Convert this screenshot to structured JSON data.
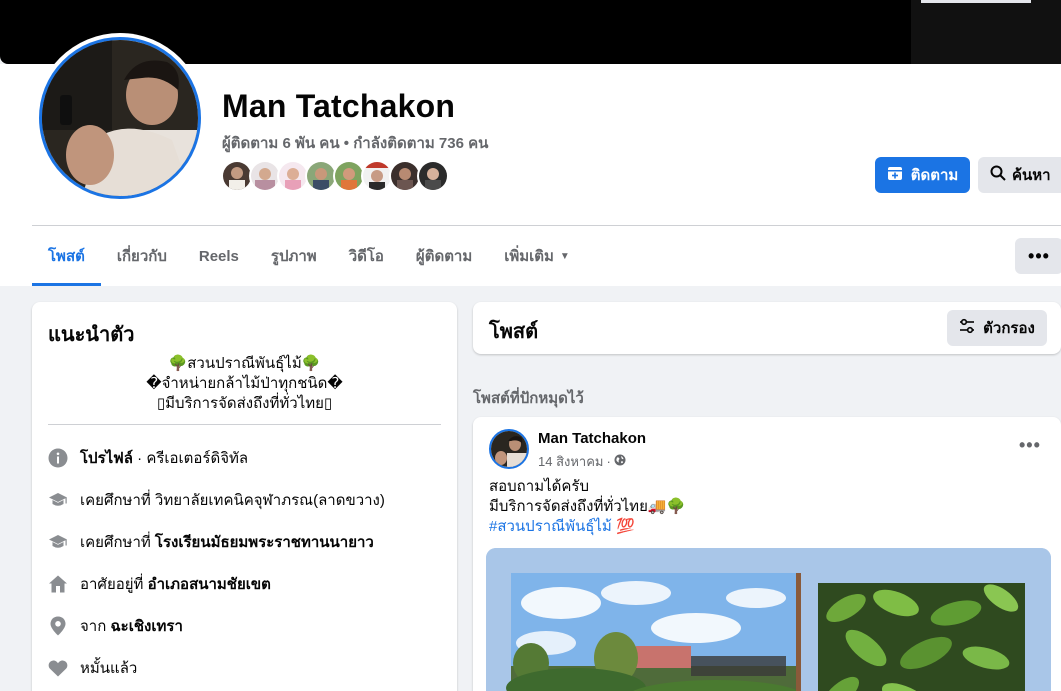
{
  "profile": {
    "name": "Man Tatchakon",
    "followers_text": "ผู้ติดตาม 6 พัน คน",
    "separator": " • ",
    "following_text": "กำลังติดตาม 736 คน",
    "follow_label": "ติดตาม",
    "search_label": "ค้นหา",
    "more_label": "•••"
  },
  "tabs": [
    {
      "label": "โพสต์"
    },
    {
      "label": "เกี่ยวกับ"
    },
    {
      "label": "Reels"
    },
    {
      "label": "รูปภาพ"
    },
    {
      "label": "วิดีโอ"
    },
    {
      "label": "ผู้ติดตาม"
    },
    {
      "label": "เพิ่มเติม"
    }
  ],
  "intro": {
    "title": "แนะนำตัว",
    "bio_lines": [
      "🌳สวนปราณีพันธุ์ไม้🌳",
      "�จำหน่ายกล้าไม้ป่าทุกชนิด�",
      "▯มีบริการจัดส่งถึงที่ทั่วไทย▯"
    ],
    "rows": [
      {
        "prefix": "",
        "bold": "โปรไฟล์",
        "suffix": " · ครีเอเตอร์ดิจิทัล",
        "icon": "info-icon"
      },
      {
        "prefix": "เคยศึกษาที่ ",
        "bold": "",
        "suffix": "วิทยาลัยเทคนิคจุฬาภรณ(ลาดขวาง)",
        "icon": "graduation-cap-icon"
      },
      {
        "prefix": "เคยศึกษาที่ ",
        "bold": "โรงเรียนมัธยมพระราชทานนายาว",
        "suffix": "",
        "icon": "graduation-cap-icon"
      },
      {
        "prefix": "อาศัยอยู่ที่ ",
        "bold": "อำเภอสนามชัยเขต",
        "suffix": "",
        "icon": "home-icon"
      },
      {
        "prefix": "จาก ",
        "bold": "ฉะเชิงเทรา",
        "suffix": "",
        "icon": "location-pin-icon"
      },
      {
        "prefix": "หมั้นแล้ว",
        "bold": "",
        "suffix": "",
        "icon": "heart-icon"
      }
    ]
  },
  "posts_section": {
    "title": "โพสต์",
    "filter_label": "ตัวกรอง",
    "pinned_label": "โพสต์ที่ปักหมุดไว้"
  },
  "post": {
    "author": "Man Tatchakon",
    "date": "14 สิงหาคม",
    "dot": "·",
    "line1": "สอบถามได้ครับ",
    "line2": "มีบริการจัดส่งถึงที่ทั่วไทย🚚🌳",
    "hashtag": "#สวนปราณีพันธุ์ไม้",
    "hashtag_emoji": " 💯",
    "options": "•••"
  },
  "colors": {
    "accent": "#1b74e4",
    "page_bg": "#f0f2f5",
    "secondary_text": "#65676b",
    "button_gray": "#e4e6eb"
  }
}
